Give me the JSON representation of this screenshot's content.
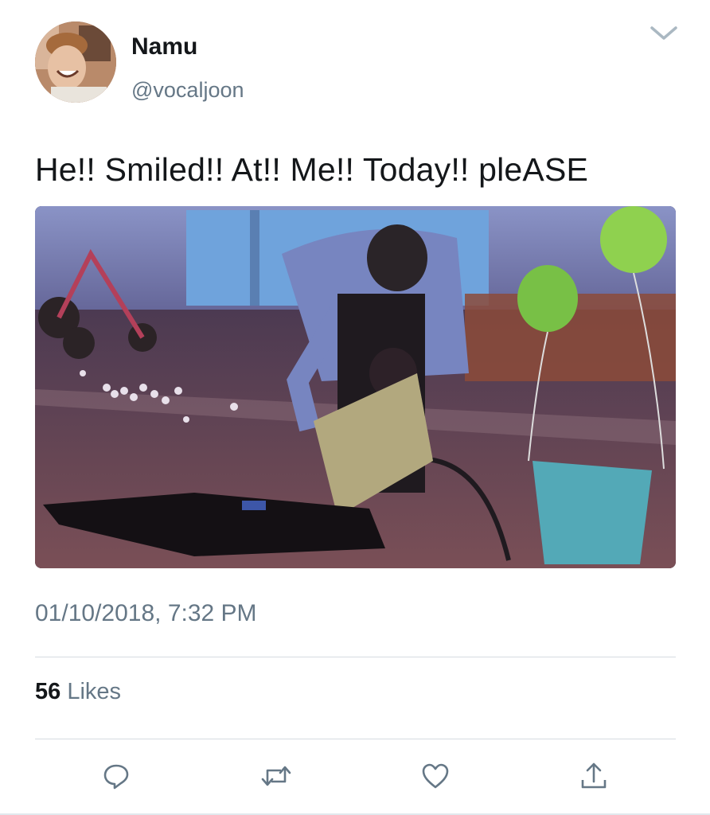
{
  "user": {
    "display_name": "Namu",
    "handle": "@vocaljoon"
  },
  "tweet": {
    "text": "He!! Smiled!! At!! Me!! Today!! pleASE",
    "timestamp": "01/10/2018, 7:32 PM"
  },
  "stats": {
    "likes_count": "56",
    "likes_label": "Likes"
  },
  "icons": {
    "menu": "chevron-down-icon",
    "reply": "reply-icon",
    "retweet": "retweet-icon",
    "like": "heart-icon",
    "share": "share-icon"
  },
  "colors": {
    "text_primary": "#14171a",
    "text_secondary": "#657786",
    "divider": "#d5dbe1",
    "icon": "#657786"
  }
}
